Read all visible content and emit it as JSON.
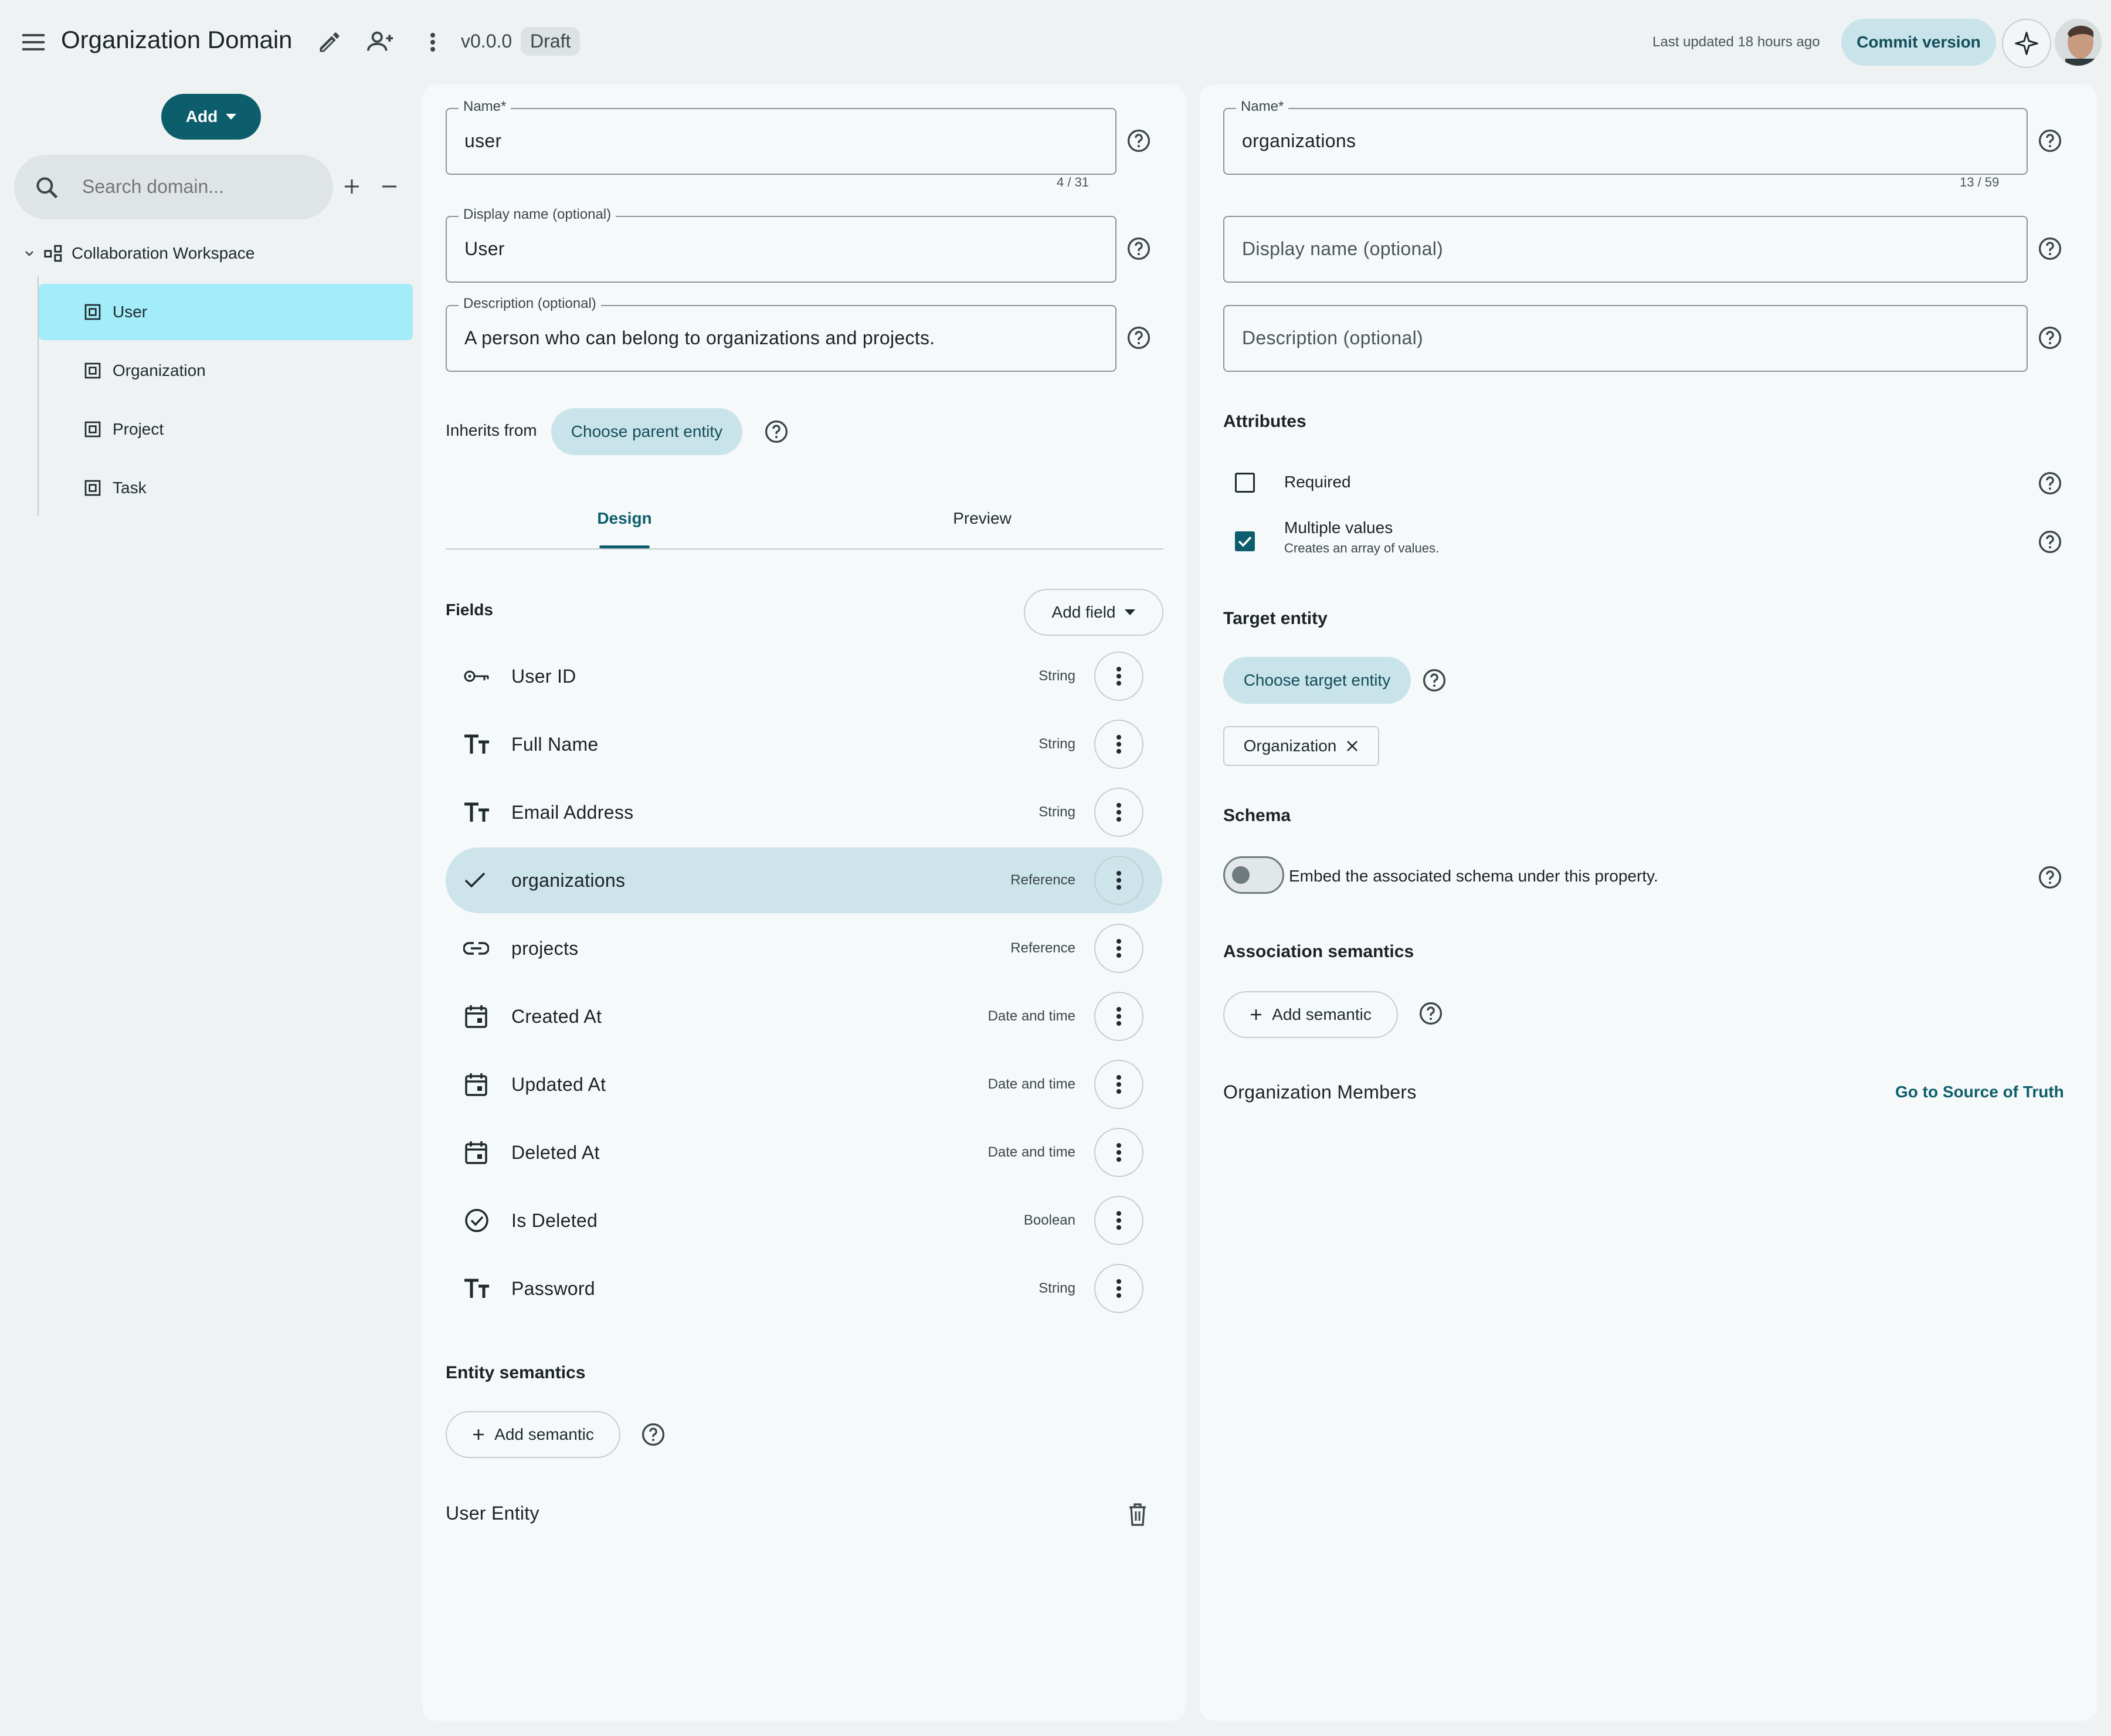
{
  "header": {
    "title": "Organization Domain",
    "version": "v0.0.0",
    "status": "Draft",
    "last_updated": "Last updated 18 hours ago",
    "commit_label": "Commit version"
  },
  "sidebar": {
    "add_label": "Add",
    "search_placeholder": "Search domain...",
    "root_label": "Collaboration Workspace",
    "items": [
      {
        "label": "User",
        "selected": true
      },
      {
        "label": "Organization",
        "selected": false
      },
      {
        "label": "Project",
        "selected": false
      },
      {
        "label": "Task",
        "selected": false
      }
    ]
  },
  "entity": {
    "name_label": "Name*",
    "name_value": "user",
    "name_counter": "4 / 31",
    "display_label": "Display name (optional)",
    "display_value": "User",
    "desc_label": "Description (optional)",
    "desc_value": "A person who can belong to organizations and projects.",
    "inherits_label": "Inherits from",
    "choose_parent": "Choose parent entity",
    "tabs": [
      "Design",
      "Preview"
    ],
    "active_tab": "Design",
    "fields_title": "Fields",
    "add_field": "Add field",
    "fields": [
      {
        "icon": "key-icon",
        "name": "User ID",
        "type": "String",
        "selected": false
      },
      {
        "icon": "text-icon",
        "name": "Full Name",
        "type": "String",
        "selected": false
      },
      {
        "icon": "text-icon",
        "name": "Email Address",
        "type": "String",
        "selected": false
      },
      {
        "icon": "check-icon",
        "name": "organizations",
        "type": "Reference",
        "selected": true
      },
      {
        "icon": "link-icon",
        "name": "projects",
        "type": "Reference",
        "selected": false
      },
      {
        "icon": "calendar-icon",
        "name": "Created At",
        "type": "Date and time",
        "selected": false
      },
      {
        "icon": "calendar-icon",
        "name": "Updated At",
        "type": "Date and time",
        "selected": false
      },
      {
        "icon": "calendar-icon",
        "name": "Deleted At",
        "type": "Date and time",
        "selected": false
      },
      {
        "icon": "check-circle-icon",
        "name": "Is Deleted",
        "type": "Boolean",
        "selected": false
      },
      {
        "icon": "text-icon",
        "name": "Password",
        "type": "String",
        "selected": false
      }
    ],
    "semantics_title": "Entity semantics",
    "add_semantic": "Add semantic",
    "footer_label": "User Entity"
  },
  "property": {
    "name_label": "Name*",
    "name_value": "organizations",
    "name_counter": "13 / 59",
    "display_placeholder": "Display name (optional)",
    "desc_placeholder": "Description (optional)",
    "attributes_title": "Attributes",
    "required_label": "Required",
    "required_checked": false,
    "multiple_label": "Multiple values",
    "multiple_sub": "Creates an array of values.",
    "multiple_checked": true,
    "target_title": "Target entity",
    "choose_target": "Choose target entity",
    "target_chip": "Organization",
    "schema_title": "Schema",
    "schema_toggle_label": "Embed the associated schema under this property.",
    "schema_toggle_on": false,
    "assoc_title": "Association semantics",
    "add_semantic": "Add semantic",
    "footer_label": "Organization Members",
    "source_link": "Go to Source of Truth"
  }
}
